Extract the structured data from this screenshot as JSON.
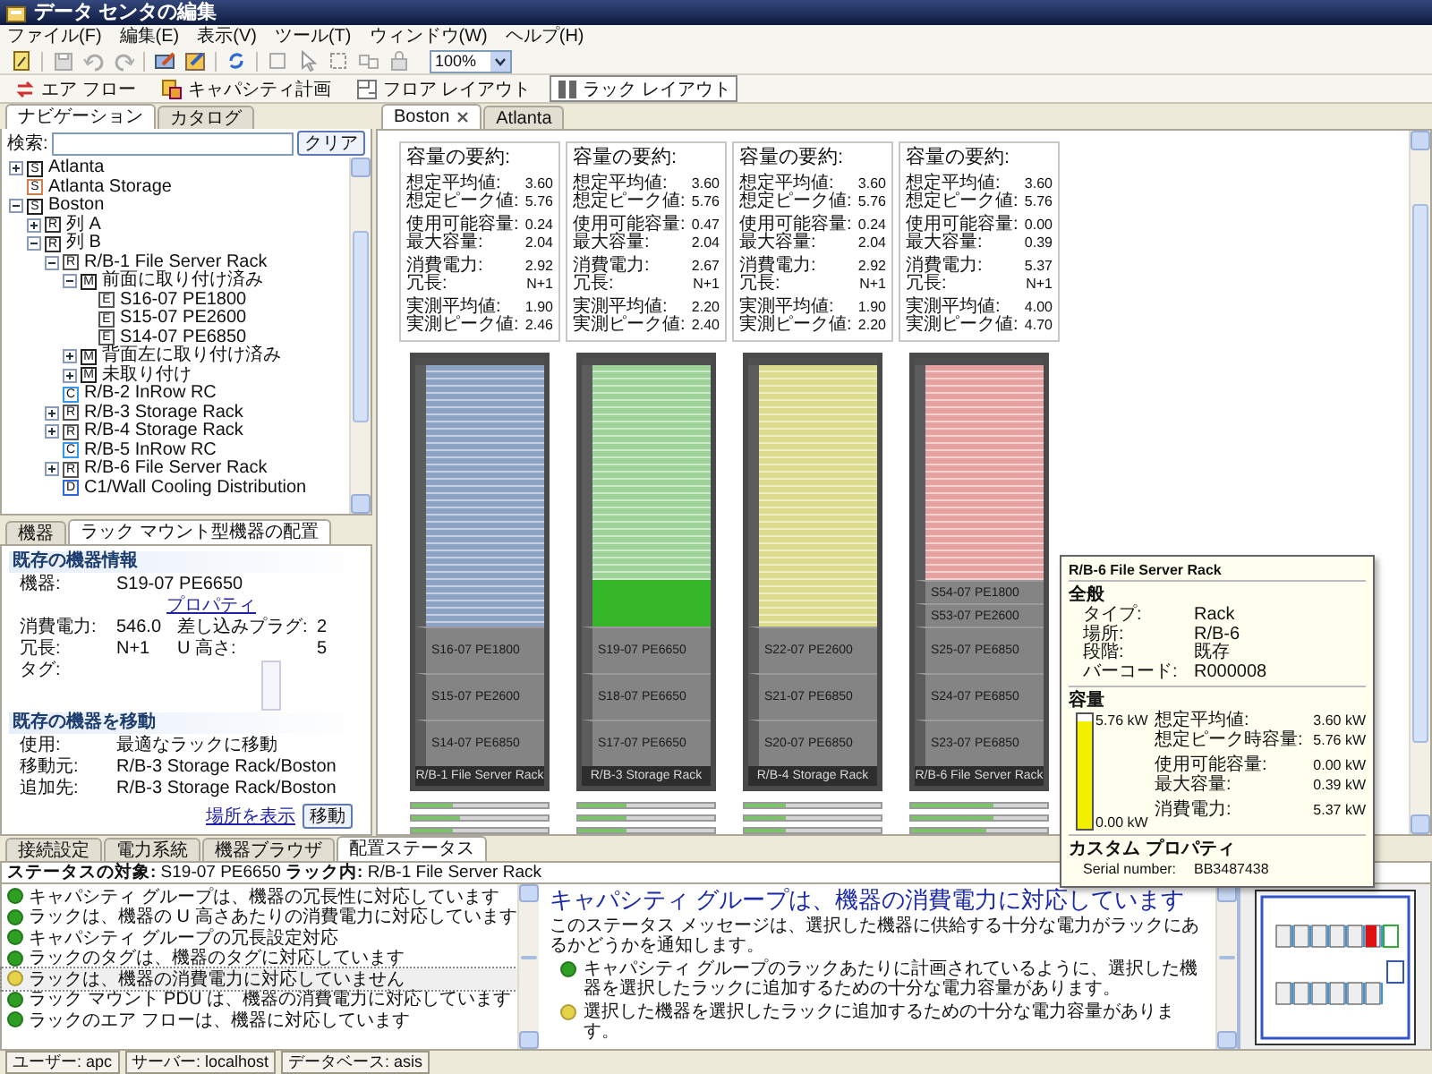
{
  "window": {
    "title": "データ センタの編集"
  },
  "menu": [
    "ファイル(F)",
    "編集(E)",
    "表示(V)",
    "ツール(T)",
    "ウィンドウ(W)",
    "ヘルプ(H)"
  ],
  "toolbar": {
    "zoom": "100%"
  },
  "perspectives": [
    {
      "label": "エア フロー",
      "selected": false
    },
    {
      "label": "キャパシティ計画",
      "selected": false
    },
    {
      "label": "フロア レイアウト",
      "selected": false
    },
    {
      "label": "ラック レイアウト",
      "selected": true
    }
  ],
  "navigator": {
    "tabs": [
      {
        "label": "ナビゲーション",
        "selected": true
      },
      {
        "label": "カタログ",
        "selected": false
      }
    ],
    "search_label": "検索:",
    "clear_button": "クリア",
    "tree": [
      {
        "badge": "S",
        "color": "#222222",
        "label": "Atlanta",
        "expanded": false
      },
      {
        "badge": "S",
        "color": "#d0804a",
        "label": "Atlanta Storage"
      },
      {
        "badge": "S",
        "color": "#222222",
        "label": "Boston",
        "expanded": true,
        "children": [
          {
            "badge": "R",
            "color": "#333333",
            "label": "列 A",
            "expanded": false
          },
          {
            "badge": "R",
            "color": "#333333",
            "label": "列 B",
            "expanded": true,
            "children": [
              {
                "badge": "R",
                "color": "#555555",
                "label": "R/B-1 File Server Rack",
                "expanded": true,
                "children": [
                  {
                    "badge": "M",
                    "color": "#222222",
                    "label": "前面に取り付け済み",
                    "expanded": true,
                    "children": [
                      {
                        "badge": "E",
                        "color": "#555555",
                        "label": "S16-07 PE1800"
                      },
                      {
                        "badge": "E",
                        "color": "#555555",
                        "label": "S15-07 PE2600"
                      },
                      {
                        "badge": "E",
                        "color": "#555555",
                        "label": "S14-07 PE6850"
                      }
                    ]
                  },
                  {
                    "badge": "M",
                    "color": "#222222",
                    "label": "背面左に取り付け済み",
                    "expanded": false
                  },
                  {
                    "badge": "M",
                    "color": "#222222",
                    "label": "未取り付け",
                    "expanded": false
                  }
                ]
              },
              {
                "badge": "C",
                "color": "#3399ee",
                "label": "R/B-2 InRow RC"
              },
              {
                "badge": "R",
                "color": "#555555",
                "label": "R/B-3 Storage Rack",
                "expanded": false
              },
              {
                "badge": "R",
                "color": "#555555",
                "label": "R/B-4 Storage Rack",
                "expanded": false
              },
              {
                "badge": "C",
                "color": "#3399ee",
                "label": "R/B-5 InRow RC"
              },
              {
                "badge": "R",
                "color": "#555555",
                "label": "R/B-6 File Server Rack",
                "expanded": false
              },
              {
                "badge": "D",
                "color": "#3366dd",
                "label": "C1/Wall Cooling Distribution"
              }
            ]
          }
        ]
      }
    ]
  },
  "placement_panel": {
    "tabs": [
      {
        "label": "機器",
        "selected": false
      },
      {
        "label": "ラック マウント型機器の配置",
        "selected": true
      }
    ],
    "existing_info": {
      "heading": "既存の機器情報",
      "device_label": "機器:",
      "device": "S19-07 PE6650",
      "properties_link": "プロパティ",
      "fields": [
        {
          "label": "消費電力:",
          "value": "546.0"
        },
        {
          "label": "差し込みプラグ:",
          "value": "2"
        },
        {
          "label": "冗長:",
          "value": "N+1"
        },
        {
          "label": "U 高さ:",
          "value": "5"
        }
      ],
      "tags_label": "タグ:"
    },
    "move": {
      "heading": "既存の機器を移動",
      "rows": [
        {
          "label": "使用:",
          "value": "最適なラックに移動"
        },
        {
          "label": "移動元:",
          "value": "R/B-3 Storage Rack/Boston"
        },
        {
          "label": "追加先:",
          "value": "R/B-3 Storage Rack/Boston"
        }
      ],
      "show_link": "場所を表示",
      "move_button": "移動"
    }
  },
  "editor": {
    "tabs": [
      {
        "label": "Boston",
        "selected": true,
        "closable": true
      },
      {
        "label": "Atlanta",
        "selected": false,
        "closable": false
      }
    ],
    "racks": [
      {
        "name": "R/B-1 File Server Rack",
        "color": "#8ea2c6",
        "summary": {
          "title": "容量の要約:",
          "groups": [
            [
              {
                "label": "想定平均値:",
                "value": "3.60"
              },
              {
                "label": "想定ピーク値:",
                "value": "5.76"
              }
            ],
            [
              {
                "label": "使用可能容量:",
                "value": "0.24"
              },
              {
                "label": "最大容量:",
                "value": "2.04"
              }
            ],
            [
              {
                "label": "消費電力:",
                "value": "2.92"
              },
              {
                "label": "冗長:",
                "value": "N+1"
              }
            ],
            [
              {
                "label": "実測平均値:",
                "value": "1.90"
              },
              {
                "label": "実測ピーク値:",
                "value": "2.46"
              }
            ]
          ]
        },
        "devices": [
          {
            "kind": "large-device",
            "label": "S16-07 PE1800"
          },
          {
            "kind": "large-device",
            "label": "S15-07 PE2600"
          },
          {
            "kind": "large-device",
            "label": "S14-07 PE6850"
          }
        ],
        "phases": [
          {
            "level": 0.3
          },
          {
            "level": 0.35
          },
          {
            "level": 0.3
          }
        ]
      },
      {
        "name": "R/B-3 Storage Rack",
        "color": "#9ed49a",
        "summary": {
          "title": "容量の要約:",
          "groups": [
            [
              {
                "label": "想定平均値:",
                "value": "3.60"
              },
              {
                "label": "想定ピーク値:",
                "value": "5.76"
              }
            ],
            [
              {
                "label": "使用可能容量:",
                "value": "0.47"
              },
              {
                "label": "最大容量:",
                "value": "2.04"
              }
            ],
            [
              {
                "label": "消費電力:",
                "value": "2.67"
              },
              {
                "label": "冗長:",
                "value": "N+1"
              }
            ],
            [
              {
                "label": "実測平均値:",
                "value": "2.20"
              },
              {
                "label": "実測ピーク値:",
                "value": "2.40"
              }
            ]
          ]
        },
        "devices": [
          {
            "kind": "placement"
          },
          {
            "kind": "large-device",
            "label": "S19-07 PE6650"
          },
          {
            "kind": "large-device",
            "label": "S18-07 PE6650"
          },
          {
            "kind": "large-device",
            "label": "S17-07 PE6650"
          }
        ],
        "phases": [
          {
            "level": 0.35
          },
          {
            "level": 0.35
          },
          {
            "level": 0.35
          }
        ]
      },
      {
        "name": "R/B-4 Storage Rack",
        "color": "#dcdc8c",
        "summary": {
          "title": "容量の要約:",
          "groups": [
            [
              {
                "label": "想定平均値:",
                "value": "3.60"
              },
              {
                "label": "想定ピーク値:",
                "value": "5.76"
              }
            ],
            [
              {
                "label": "使用可能容量:",
                "value": "0.24"
              },
              {
                "label": "最大容量:",
                "value": "2.04"
              }
            ],
            [
              {
                "label": "消費電力:",
                "value": "2.92"
              },
              {
                "label": "冗長:",
                "value": "N+1"
              }
            ],
            [
              {
                "label": "実測平均値:",
                "value": "1.90"
              },
              {
                "label": "実測ピーク値:",
                "value": "2.20"
              }
            ]
          ]
        },
        "devices": [
          {
            "kind": "large-device",
            "label": "S22-07 PE2600"
          },
          {
            "kind": "large-device",
            "label": "S21-07 PE6850"
          },
          {
            "kind": "large-device",
            "label": "S20-07 PE6850"
          }
        ],
        "phases": [
          {
            "level": 0.3
          },
          {
            "level": 0.3
          },
          {
            "level": 0.3
          }
        ]
      },
      {
        "name": "R/B-6 File Server Rack",
        "color": "#e6a2a2",
        "summary": {
          "title": "容量の要約:",
          "groups": [
            [
              {
                "label": "想定平均値:",
                "value": "3.60"
              },
              {
                "label": "想定ピーク値:",
                "value": "5.76"
              }
            ],
            [
              {
                "label": "使用可能容量:",
                "value": "0.00"
              },
              {
                "label": "最大容量:",
                "value": "0.39"
              }
            ],
            [
              {
                "label": "消費電力:",
                "value": "5.37"
              },
              {
                "label": "冗長:",
                "value": "N+1"
              }
            ],
            [
              {
                "label": "実測平均値:",
                "value": "4.00"
              },
              {
                "label": "実測ピーク値:",
                "value": "4.70"
              }
            ]
          ]
        },
        "devices": [
          {
            "kind": "small-device",
            "label": "S54-07 PE1800"
          },
          {
            "kind": "small-device",
            "label": "S53-07 PE2600"
          },
          {
            "kind": "large-device",
            "label": "S25-07 PE6850"
          },
          {
            "kind": "large-device",
            "label": "S24-07 PE6850"
          },
          {
            "kind": "large-device",
            "label": "S23-07 PE6850"
          }
        ],
        "phases": [
          {
            "level": 0.6
          },
          {
            "level": 0.6
          },
          {
            "level": 0.55
          }
        ]
      }
    ],
    "tooltip": {
      "title": "R/B-6 File Server Rack",
      "general_heading": "全般",
      "general": [
        {
          "label": "タイプ:",
          "value": "Rack"
        },
        {
          "label": "場所:",
          "value": "R/B-6"
        },
        {
          "label": "段階:",
          "value": "既存"
        },
        {
          "label": "バーコード:",
          "value": "R000008"
        }
      ],
      "capacity_heading": "容量",
      "capacity": {
        "level": 0.93,
        "max_label": "5.76 kW",
        "min_label": "0.00 kW",
        "groups": [
          [
            {
              "label": "想定平均値:",
              "value": "3.60 kW"
            },
            {
              "label": "想定ピーク時容量:",
              "value": "5.76 kW"
            }
          ],
          [
            {
              "label": "使用可能容量:",
              "value": "0.00 kW"
            },
            {
              "label": "最大容量:",
              "value": "0.39 kW"
            }
          ],
          [
            {
              "label": "消費電力:",
              "value": "5.37 kW"
            }
          ]
        ]
      },
      "custom_heading": "カスタム プロパティ",
      "custom": [
        {
          "label": "Serial number:",
          "value": "BB3487438"
        }
      ]
    }
  },
  "bottom": {
    "tabs": [
      {
        "label": "接続設定",
        "selected": false
      },
      {
        "label": "電力系統",
        "selected": false
      },
      {
        "label": "機器ブラウザ",
        "selected": false
      },
      {
        "label": "配置ステータス",
        "selected": true
      }
    ],
    "target": "**ステータスの対象:** S19-07 PE6650 **ラック内:** R/B-1 File Server Rack",
    "statuses": [
      {
        "text": "キャパシティ グループは、機器の冗長性に対応しています",
        "color": "#2f9e25",
        "selected": false
      },
      {
        "text": "ラックは、機器の U 高さあたりの消費電力に対応しています",
        "color": "#2f9e25",
        "selected": false
      },
      {
        "text": "キャパシティ グループの冗長設定対応",
        "color": "#2f9e25",
        "selected": false
      },
      {
        "text": "ラックのタグは、機器のタグに対応しています",
        "color": "#2f9e25",
        "selected": false
      },
      {
        "text": "ラックは、機器の消費電力に対応していません",
        "color": "#e6d34a",
        "selected": true
      },
      {
        "text": "ラック マウント PDU は、機器の消費電力に対応しています",
        "color": "#2f9e25",
        "selected": false
      },
      {
        "text": "ラックのエア フローは、機器に対応しています",
        "color": "#2f9e25",
        "selected": false
      }
    ],
    "detail": {
      "title": "キャパシティ グループは、機器の消費電力に対応しています",
      "message": "このステータス メッセージは、選択した機器に供給する十分な電力がラックにあるかどうかを通知します。",
      "items": [
        {
          "text": "キャパシティ グループのラックあたりに計画されているように、選択した機器を選択したラックに追加するための十分な電力容量があります。",
          "color": "#2f9e25"
        },
        {
          "text": "選択した機器を選択したラックに追加するための十分な電力容量があります。",
          "color": "#e6d34a"
        }
      ]
    }
  },
  "status_bar": [
    "ユーザー: apc",
    "サーバー: localhost",
    "データベース: asis"
  ]
}
